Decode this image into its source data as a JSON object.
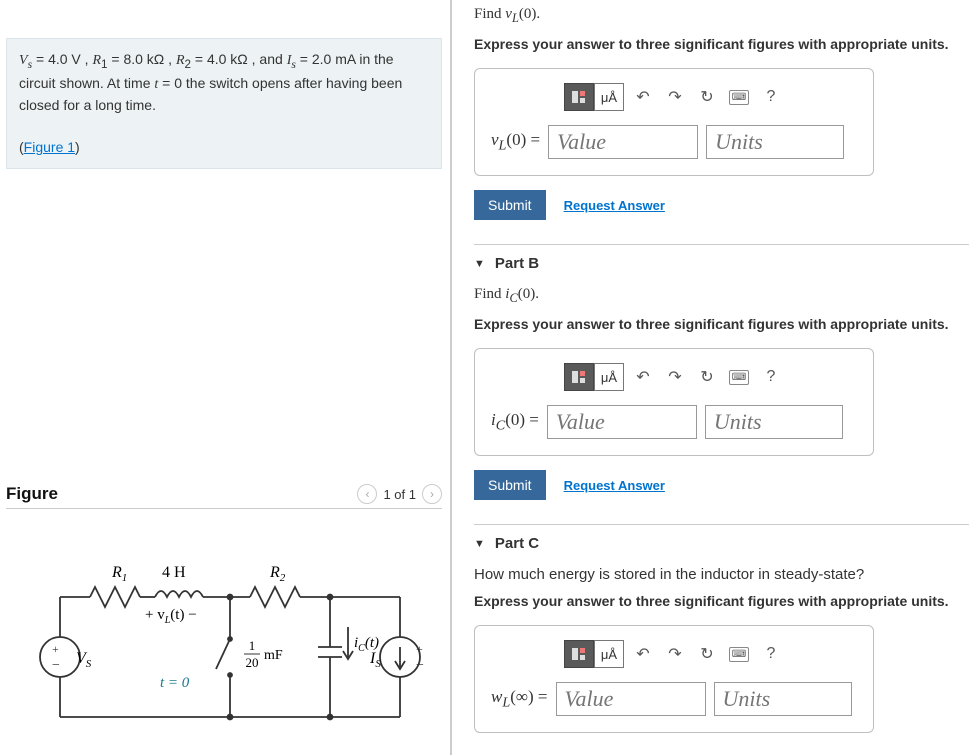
{
  "problem": {
    "statement_prefix": " = 4.0 V , ",
    "statement_r1": " = 8.0 kΩ , ",
    "statement_r2": " = 4.0 kΩ , and ",
    "statement_is": " = 2.0 mA in the circuit shown. At time ",
    "statement_t": " the switch opens after having been closed for a long time.",
    "figure_link": "Figure 1"
  },
  "figure": {
    "title": "Figure",
    "pager": "1 of 1"
  },
  "circuit": {
    "r1": "R",
    "r1sub": "1",
    "ind": "4 H",
    "r2": "R",
    "r2sub": "2",
    "vl": "+ v",
    "vlsub": "L",
    "vlarg": "(t) −",
    "vs": "V",
    "vssub": "S",
    "t0": "t = 0",
    "cap_num": "1",
    "cap_den": "20",
    "cap_unit": "mF",
    "ic": "i",
    "icsub": "C",
    "icarg": "(t)",
    "is": "I",
    "issub": "S"
  },
  "partA": {
    "find_pre": "Find ",
    "find_var": "v",
    "find_sub": "L",
    "find_arg": "(0).",
    "instruct": "Express your answer to three significant figures with appropriate units.",
    "lhs_var": "v",
    "lhs_sub": "L",
    "lhs_arg": "(0) =",
    "value_ph": "Value",
    "units_ph": "Units",
    "unit_btn": "μÅ",
    "submit": "Submit",
    "request": "Request Answer"
  },
  "partB": {
    "title": "Part B",
    "find_pre": "Find ",
    "find_var": "i",
    "find_sub": "C",
    "find_arg": "(0).",
    "instruct": "Express your answer to three significant figures with appropriate units.",
    "lhs_var": "i",
    "lhs_sub": "C",
    "lhs_arg": "(0) =",
    "value_ph": "Value",
    "units_ph": "Units",
    "unit_btn": "μÅ",
    "submit": "Submit",
    "request": "Request Answer"
  },
  "partC": {
    "title": "Part C",
    "question": "How much energy is stored in the inductor in steady-state?",
    "instruct": "Express your answer to three significant figures with appropriate units.",
    "lhs_var": "w",
    "lhs_sub": "L",
    "lhs_arg": "(∞) =",
    "value_ph": "Value",
    "units_ph": "Units",
    "unit_btn": "μÅ"
  },
  "help": "?"
}
